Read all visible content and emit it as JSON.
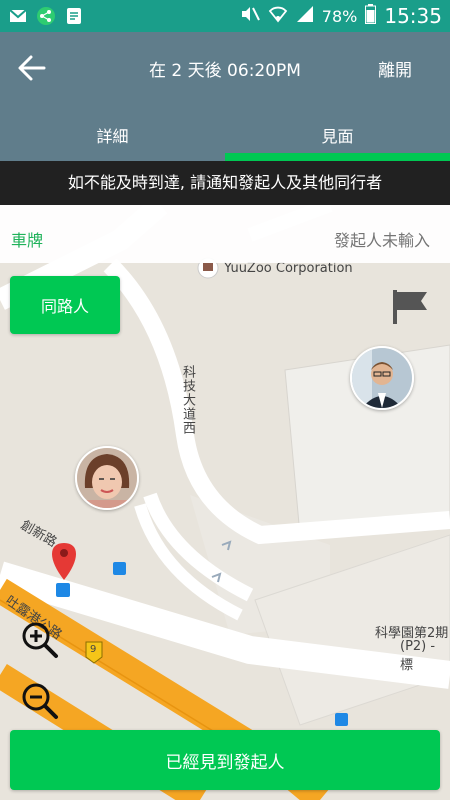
{
  "status_bar": {
    "left_icons": [
      "mail-icon",
      "share-icon",
      "notes-icon"
    ],
    "battery": "78%",
    "time": "15:35"
  },
  "app_bar": {
    "title": "在 2 天後 06:20PM",
    "leave_label": "離開"
  },
  "tabs": [
    {
      "label": "詳細",
      "active": false
    },
    {
      "label": "見面",
      "active": true
    }
  ],
  "notice": "如不能及時到達, 請通知發起人及其他同行者",
  "plate": {
    "label": "車牌",
    "value": "發起人未輸入"
  },
  "map": {
    "poi": "YuuZoo Corporation",
    "roads": {
      "tech_ave_w": "科技大道西",
      "chuangxin": "創新路",
      "tolo": "吐露港公路"
    },
    "science_park_line1": "科學園第2期",
    "science_park_line2": "(P2) - 標",
    "route_badge": "9"
  },
  "buttons": {
    "companions": "同路人",
    "met_initiator": "已經見到發起人"
  },
  "colors": {
    "accent": "#00c853",
    "app_bar": "#607d8b",
    "status_bar": "#1a9e8a"
  }
}
